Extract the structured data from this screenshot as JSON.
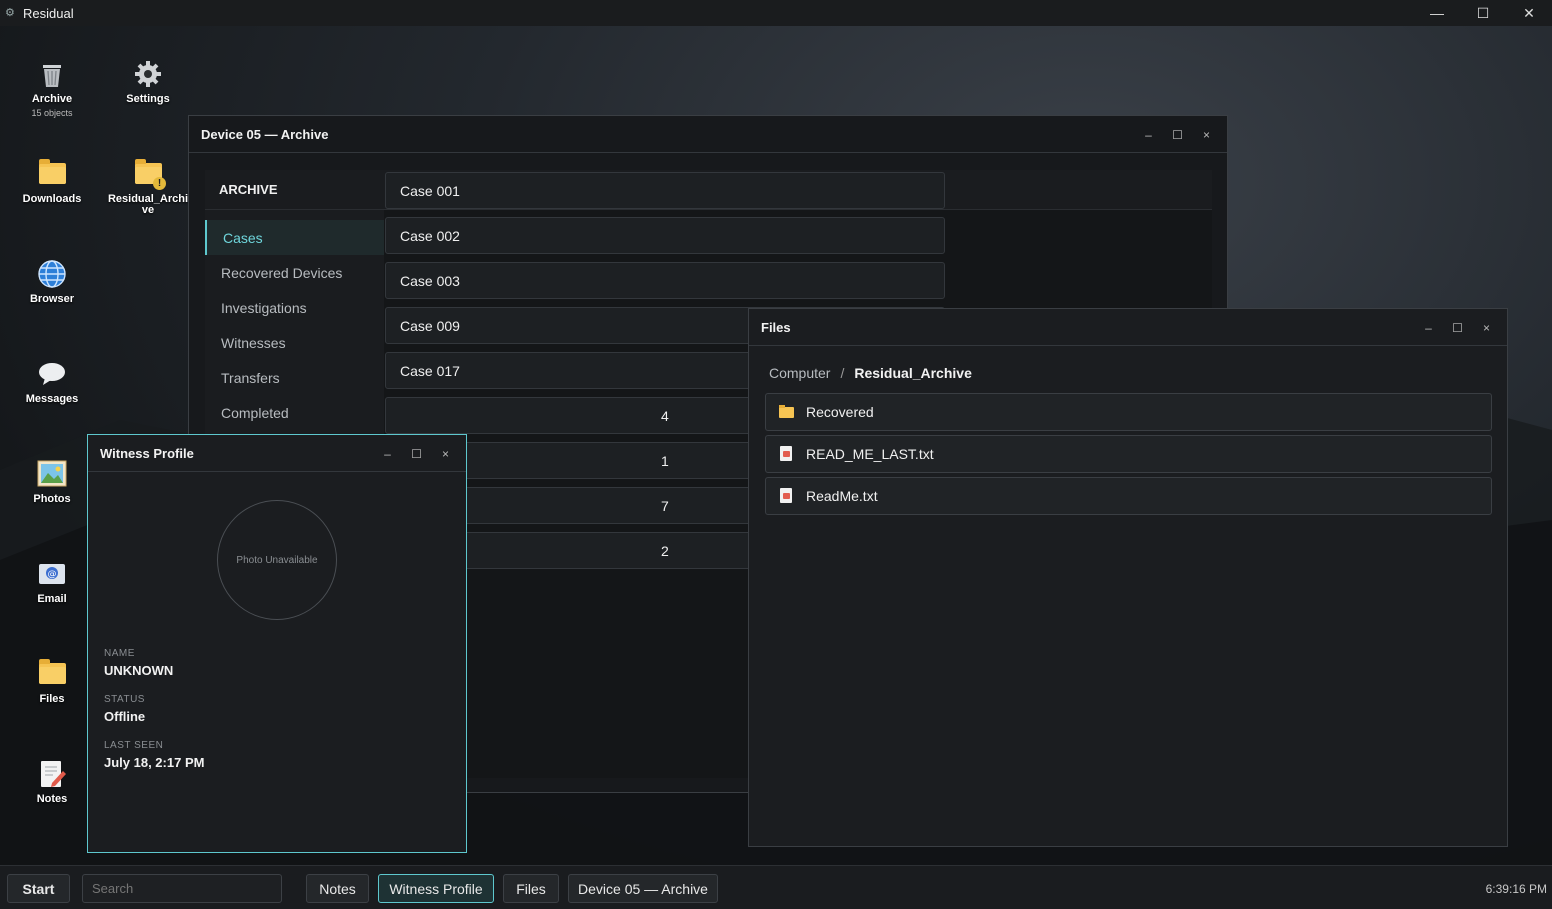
{
  "app": {
    "title": "Residual",
    "icon": "gear-icon"
  },
  "desktop": {
    "icons": [
      {
        "label": "Archive",
        "sub": "15 objects",
        "icon": "trash-icon"
      },
      {
        "label": "Settings",
        "icon": "gear-icon"
      },
      {
        "label": "Downloads",
        "icon": "folder-icon"
      },
      {
        "label": "Residual_Archive",
        "icon": "folder-warning-icon"
      },
      {
        "label": "Browser",
        "icon": "globe-icon"
      },
      {
        "label": "Messages",
        "icon": "chat-icon"
      },
      {
        "label": "Photos",
        "icon": "image-icon"
      },
      {
        "label": "Email",
        "icon": "mail-icon"
      },
      {
        "label": "Files",
        "icon": "folder-icon"
      },
      {
        "label": "Notes",
        "icon": "notes-icon"
      }
    ]
  },
  "archive_window": {
    "title": "Device 05 — Archive",
    "header": "ARCHIVE",
    "sidebar": [
      "Cases",
      "Recovered Devices",
      "Investigations",
      "Witnesses",
      "Transfers",
      "Completed"
    ],
    "active_sidebar": "Cases",
    "cases": [
      "Case 001",
      "Case 002",
      "Case 003",
      "Case 009",
      "Case 017",
      "4",
      "1",
      "7",
      "2"
    ]
  },
  "files_window": {
    "title": "Files",
    "breadcrumb": {
      "root": "Computer",
      "separator": "/",
      "current": "Residual_Archive"
    },
    "items": [
      {
        "name": "Recovered",
        "type": "folder"
      },
      {
        "name": "READ_ME_LAST.txt",
        "type": "text"
      },
      {
        "name": "ReadMe.txt",
        "type": "text"
      }
    ]
  },
  "witness_window": {
    "title": "Witness Profile",
    "photo_text": "Photo Unavailable",
    "fields": [
      {
        "key": "NAME",
        "value": "UNKNOWN"
      },
      {
        "key": "STATUS",
        "value": "Offline"
      },
      {
        "key": "LAST SEEN",
        "value": "July 18, 2:17 PM"
      }
    ]
  },
  "window_controls": {
    "minimize": "–",
    "maximize": "☐",
    "close": "×"
  },
  "app_controls": {
    "minimize": "—",
    "maximize": "☐",
    "close": "✕"
  },
  "taskbar": {
    "start": "Start",
    "search_placeholder": "Search",
    "buttons": [
      "Notes",
      "Witness Profile",
      "Files",
      "Device 05 — Archive"
    ],
    "active_button": "Witness Profile",
    "clock": "6:39:16 PM"
  },
  "colors": {
    "accent": "#5ec8ce",
    "folder": "#f6c453",
    "background": "#1b1d20"
  }
}
